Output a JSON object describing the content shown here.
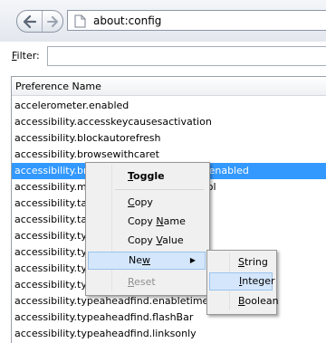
{
  "address": {
    "url": "about:config"
  },
  "filter": {
    "label_accesskey": "F",
    "label_rest": "ilter:",
    "value": ""
  },
  "columns": {
    "preference_name": "Preference Name"
  },
  "rows": [
    "accelerometer.enabled",
    "accessibility.accesskeycausesactivation",
    "accessibility.blockautorefresh",
    "accessibility.browsewithcaret",
    "accessibility.browsewithcaret_shortcut.enabled",
    "accessibility.mouse_focuses_formcontrol",
    "accessibility.tabfocus",
    "accessibility.tabfocus_applies_to_xul",
    "accessibility.typeaheadfind",
    "accessibility.typeaheadfind.autostart",
    "accessibility.typeaheadfind.casesensitive",
    "accessibility.typeaheadfind.enablesound",
    "accessibility.typeaheadfind.enabletimeout",
    "accessibility.typeaheadfind.flashBar",
    "accessibility.typeaheadfind.linksonly"
  ],
  "context_menu": {
    "toggle": {
      "ak": "T",
      "rest": "oggle"
    },
    "copy": {
      "ak": "C",
      "rest": "opy"
    },
    "copy_name": {
      "pre": "Copy ",
      "ak": "N",
      "rest": "ame"
    },
    "copy_value": {
      "pre": "Copy ",
      "ak": "V",
      "rest": "alue"
    },
    "new": {
      "pre": "Ne",
      "ak": "w"
    },
    "reset": {
      "ak": "R",
      "rest": "eset"
    }
  },
  "submenu": {
    "string": {
      "ak": "S",
      "rest": "tring"
    },
    "integer": {
      "ak": "I",
      "rest": "nteger"
    },
    "boolean": {
      "ak": "B",
      "rest": "oolean"
    }
  },
  "colors": {
    "selection": "#3399ff",
    "menu_hover": "#d4e6fb"
  },
  "icons": [
    "back-arrow-icon",
    "forward-arrow-icon",
    "page-icon",
    "submenu-arrow-icon"
  ]
}
